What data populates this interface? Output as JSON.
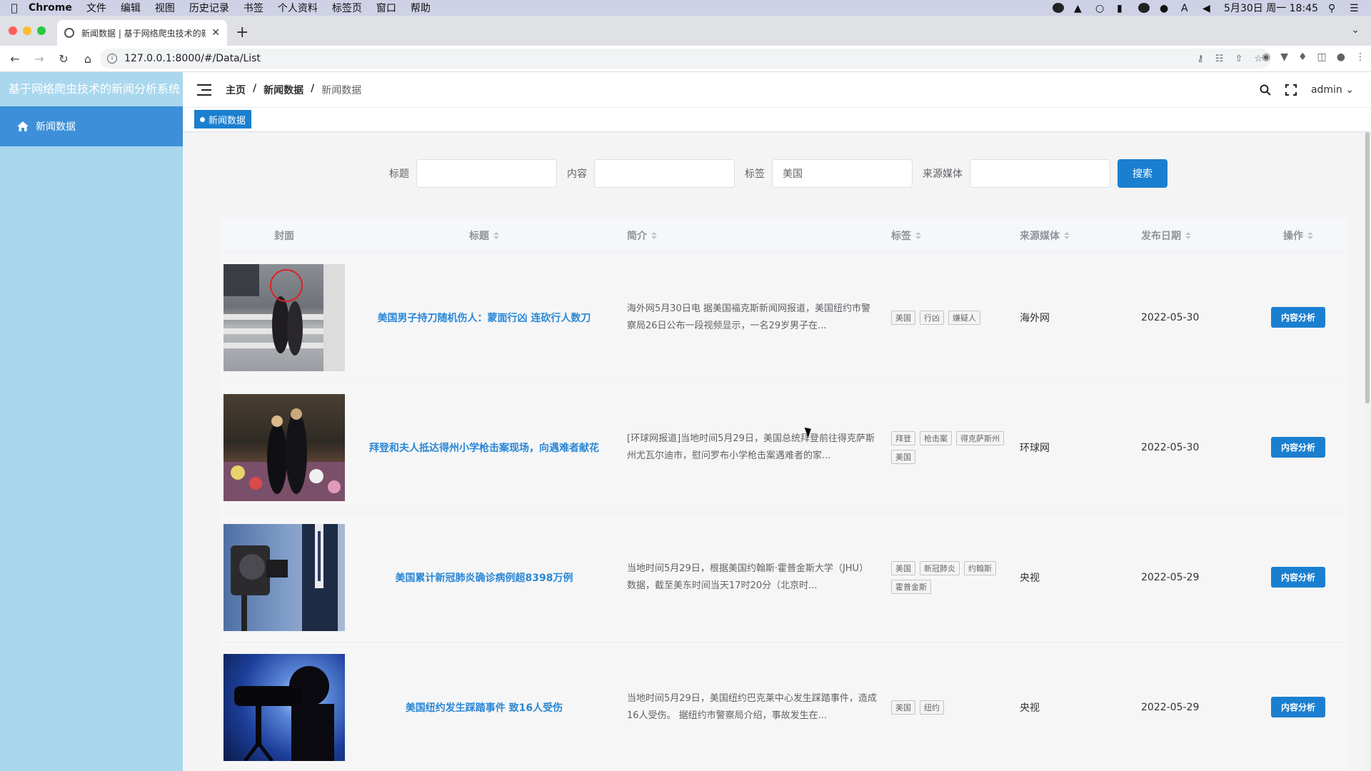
{
  "menubar": {
    "app": "Chrome",
    "items": [
      "文件",
      "编辑",
      "视图",
      "历史记录",
      "书签",
      "个人资料",
      "标签页",
      "窗口",
      "帮助"
    ],
    "datetime": "5月30日 周一 18:45"
  },
  "browser": {
    "tab_title": "新闻数据 | 基于网络爬虫技术的新",
    "url": "127.0.0.1:8000/#/Data/List"
  },
  "sidebar": {
    "logo": "基于网络爬虫技术的新闻分析系统",
    "items": [
      {
        "label": "新闻数据",
        "icon": "home-icon"
      }
    ]
  },
  "header": {
    "breadcrumb": [
      "主页",
      "新闻数据",
      "新闻数据"
    ],
    "user": "admin"
  },
  "tagsview": {
    "active": "新闻数据"
  },
  "filter": {
    "title_label": "标题",
    "content_label": "内容",
    "tag_label": "标签",
    "tag_value": "美国",
    "source_label": "来源媒体",
    "search_button": "搜索"
  },
  "table": {
    "columns": [
      "封面",
      "标题",
      "简介",
      "标签",
      "来源媒体",
      "发布日期",
      "操作"
    ],
    "rows": [
      {
        "title": "美国男子持刀随机伤人：蒙面行凶 连砍行人数刀",
        "intro": "海外网5月30日电 据美国福克斯新闻网报道，美国纽约市警察局26日公布一段视频显示，一名29岁男子在...",
        "tags": [
          "美国",
          "行凶",
          "嫌疑人"
        ],
        "source": "海外网",
        "date": "2022-05-30",
        "action": "内容分析"
      },
      {
        "title": "拜登和夫人抵达得州小学枪击案现场，向遇难者献花",
        "intro": "[环球网报道]当地时间5月29日，美国总统拜登前往得克萨斯州尤瓦尔迪市，慰问罗布小学枪击案遇难者的家...",
        "tags": [
          "拜登",
          "枪击案",
          "得克萨斯州",
          "美国"
        ],
        "source": "环球网",
        "date": "2022-05-30",
        "action": "内容分析"
      },
      {
        "title": "美国累计新冠肺炎确诊病例超8398万例",
        "intro": "当地时间5月29日，根据美国约翰斯·霍普金斯大学（JHU）数据，截至美东时间当天17时20分（北京时...",
        "tags": [
          "美国",
          "新冠肺炎",
          "约翰斯",
          "霍普金斯"
        ],
        "source": "央视",
        "date": "2022-05-29",
        "action": "内容分析"
      },
      {
        "title": "美国纽约发生踩踏事件 致16人受伤",
        "intro": "当地时间5月29日，美国纽约巴克莱中心发生踩踏事件，造成16人受伤。 据纽约市警察局介绍，事故发生在...",
        "tags": [
          "美国",
          "纽约"
        ],
        "source": "央视",
        "date": "2022-05-29",
        "action": "内容分析"
      }
    ]
  }
}
